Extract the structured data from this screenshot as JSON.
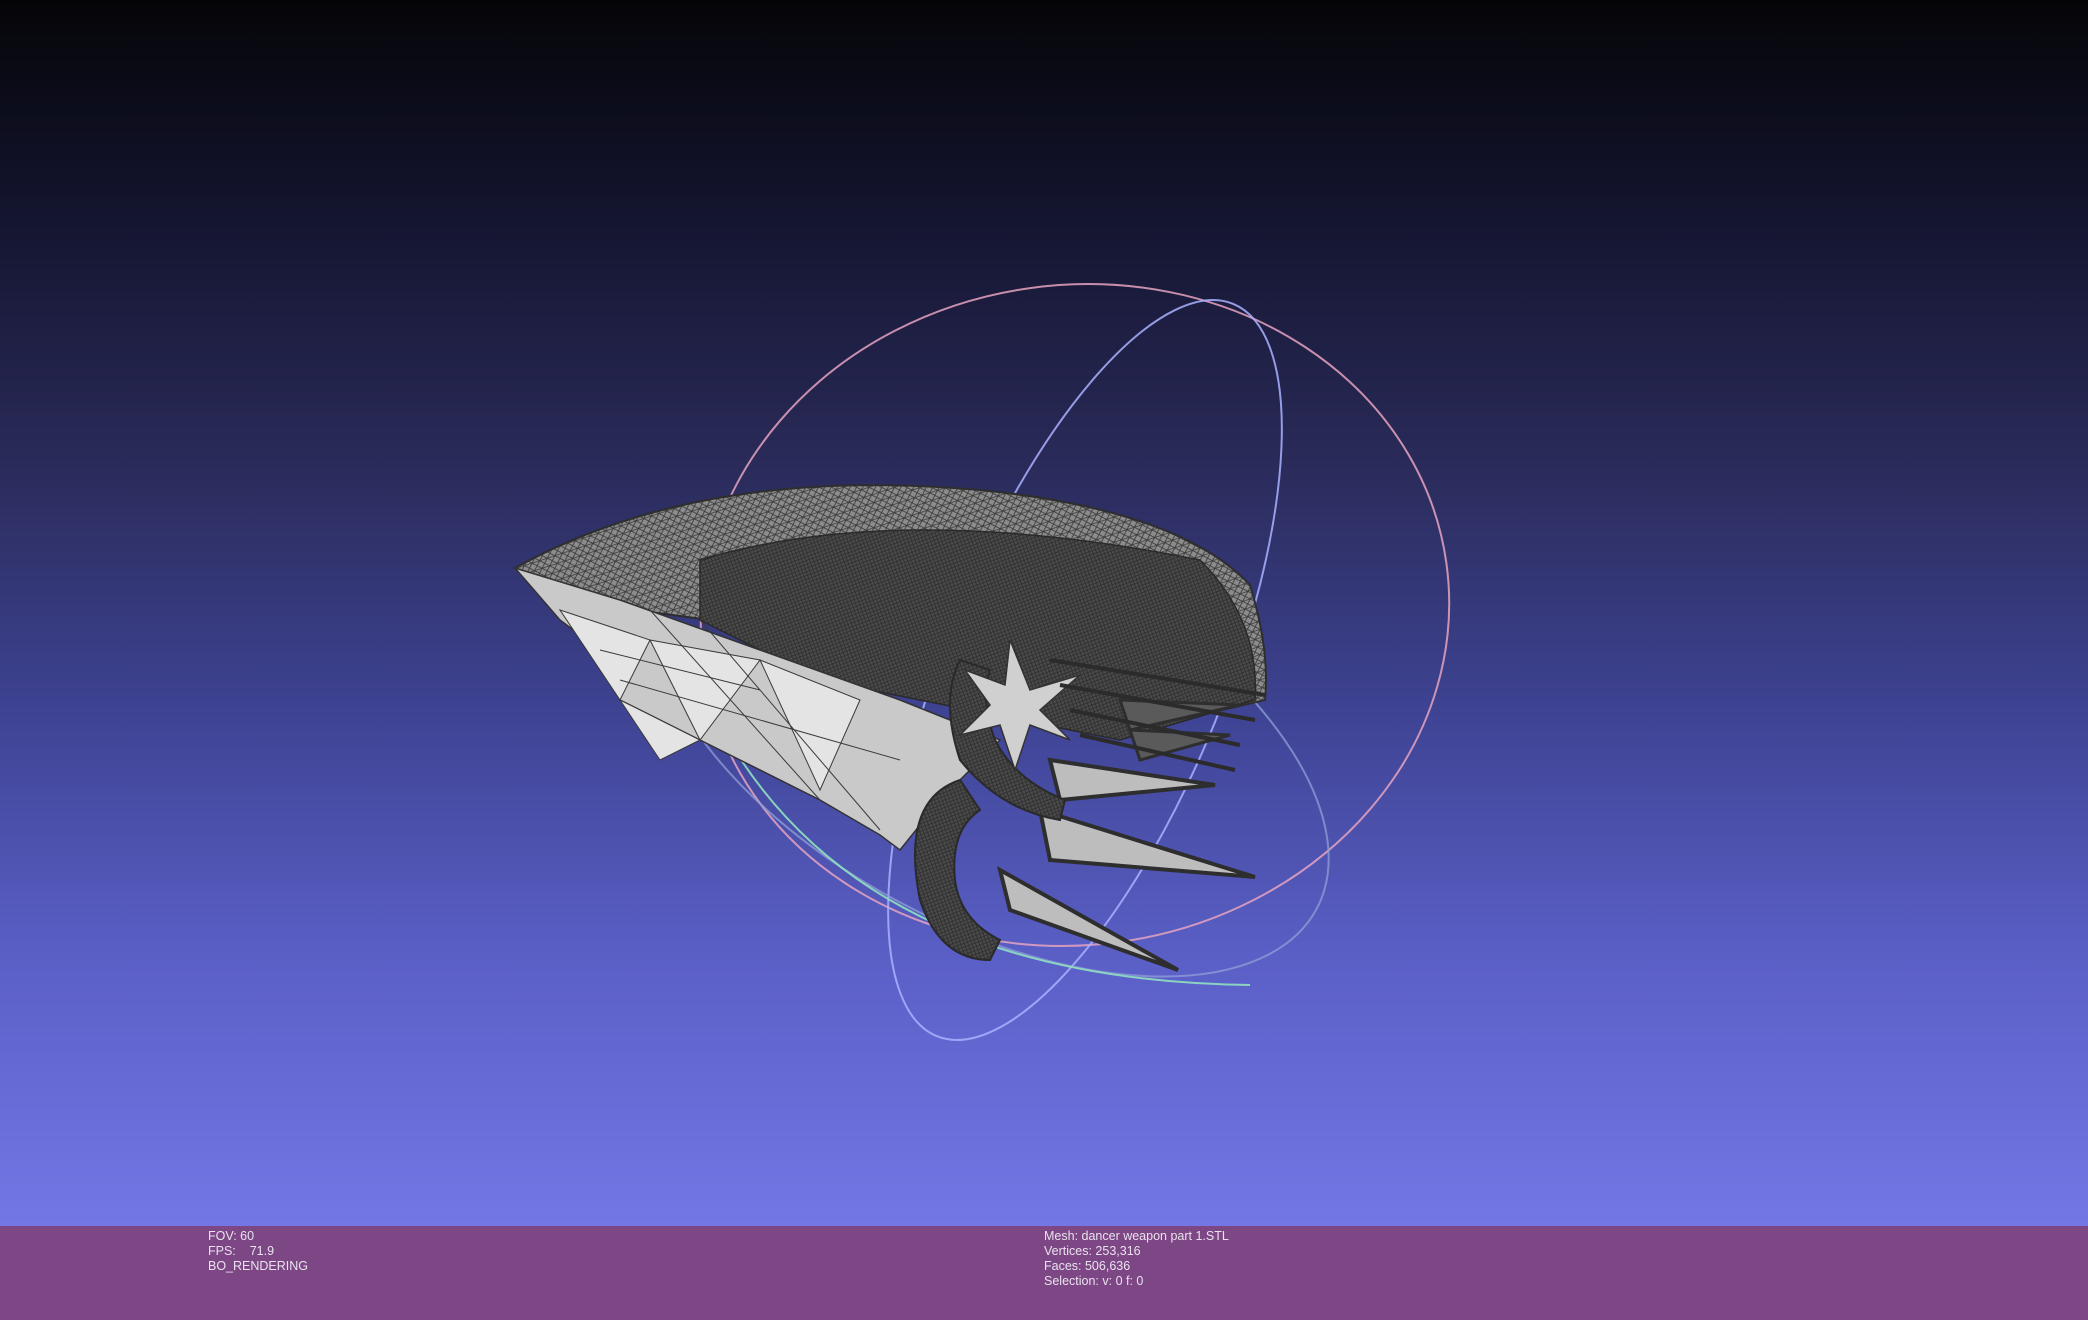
{
  "viewport": {
    "background_top": "#050508",
    "background_bottom": "#7377e6",
    "mesh_color": "#bfbfbf",
    "wire_color": "#3a3a3a",
    "trackball_colors": [
      "#e6a3c0",
      "#aab2ff",
      "#8fe0c0"
    ]
  },
  "status": {
    "fov": "FOV: 60",
    "fps_label": "FPS:",
    "fps_value": "71.9",
    "render_mode": "BO_RENDERING",
    "mesh": "Mesh: dancer weapon part 1.STL",
    "vertices": "Vertices: 253,316",
    "faces": "Faces: 506,636",
    "selection": "Selection: v: 0 f: 0"
  }
}
